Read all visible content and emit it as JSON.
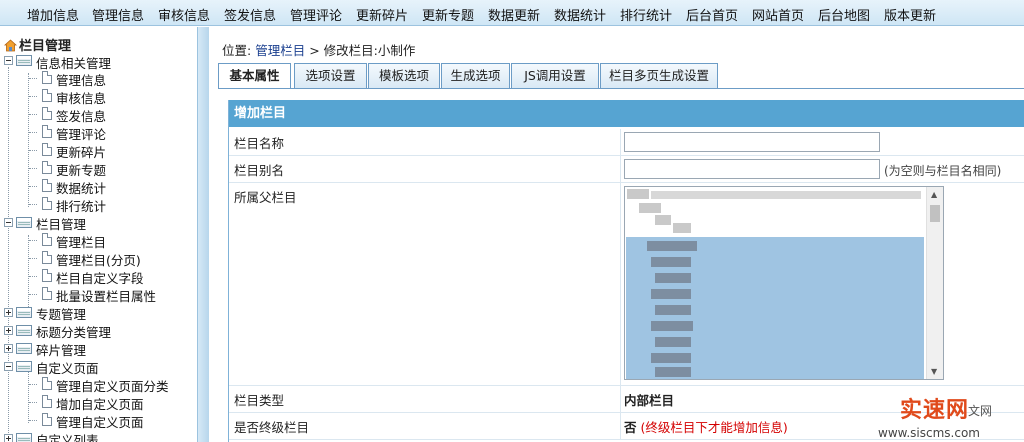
{
  "topnav": [
    "增加信息",
    "管理信息",
    "审核信息",
    "签发信息",
    "管理评论",
    "更新碎片",
    "更新专题",
    "数据更新",
    "数据统计",
    "排行统计",
    "后台首页",
    "网站首页",
    "后台地图",
    "版本更新"
  ],
  "sidebar": {
    "root": "栏目管理",
    "groups": [
      {
        "label": "信息相关管理",
        "children": [
          "管理信息",
          "审核信息",
          "签发信息",
          "管理评论",
          "更新碎片",
          "更新专题",
          "数据统计",
          "排行统计"
        ]
      },
      {
        "label": "栏目管理",
        "children": [
          "管理栏目",
          "管理栏目(分页)",
          "栏目自定义字段",
          "批量设置栏目属性"
        ]
      },
      {
        "label": "专题管理",
        "children": []
      },
      {
        "label": "标题分类管理",
        "children": []
      },
      {
        "label": "碎片管理",
        "children": []
      },
      {
        "label": "自定义页面",
        "children": [
          "管理自定义页面分类",
          "增加自定义页面",
          "管理自定义页面"
        ]
      },
      {
        "label": "自定义列表",
        "children": []
      }
    ]
  },
  "breadcrumb": {
    "prefix": "位置:",
    "link": "管理栏目",
    "rest": "> 修改栏目:小制作"
  },
  "tabs": [
    "基本属性",
    "选项设置",
    "模板选项",
    "生成选项",
    "JS调用设置",
    "栏目多页生成设置"
  ],
  "panel": {
    "title": "增加栏目",
    "fields": {
      "name": {
        "label": "栏目名称",
        "value": ""
      },
      "alias": {
        "label": "栏目别名",
        "value": "",
        "hint": "(为空则与栏目名相同)"
      },
      "parent": {
        "label": "所属父栏目"
      },
      "type": {
        "label": "栏目类型",
        "value": "内部栏目"
      },
      "final": {
        "label": "是否终级栏目",
        "value": "否",
        "note": "(终级栏目下才能增加信息)"
      }
    }
  },
  "watermark": {
    "big": "实速网",
    "small": "文网",
    "url": "www.siscms.com"
  },
  "colors": {
    "panel_header": "#56a4d2",
    "selection": "#9fc4e2",
    "red_note": "#d40000",
    "link": "#1a3f8f"
  }
}
